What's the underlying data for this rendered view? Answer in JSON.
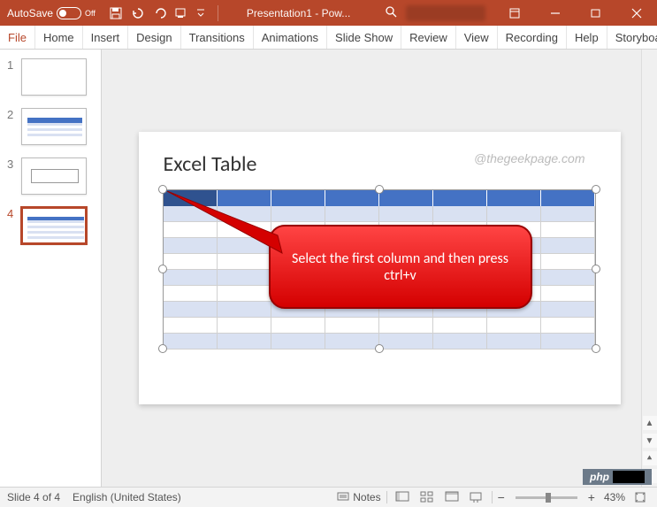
{
  "titleBar": {
    "autoSaveLabel": "AutoSave",
    "autoSaveStateLabel": "Off",
    "documentTitle": "Presentation1 - Pow..."
  },
  "ribbonTabs": {
    "file": "File",
    "home": "Home",
    "insert": "Insert",
    "design": "Design",
    "transitions": "Transitions",
    "animations": "Animations",
    "slideShow": "Slide Show",
    "review": "Review",
    "view": "View",
    "recording": "Recording",
    "help": "Help",
    "storyboarding": "Storyboardin"
  },
  "thumbnails": {
    "slide1Num": "1",
    "slide2Num": "2",
    "slide3Num": "3",
    "slide4Num": "4"
  },
  "slide": {
    "title": "Excel Table",
    "watermark": "@thegeekpage.com",
    "calloutText": "Select the first column and then press ctrl+v"
  },
  "statusBar": {
    "slideIndicator": "Slide 4 of 4",
    "language": "English (United States)",
    "notesLabel": "Notes",
    "zoomMinus": "−",
    "zoomPlus": "+",
    "zoomValue": "43%"
  },
  "badge": {
    "text": "php"
  }
}
